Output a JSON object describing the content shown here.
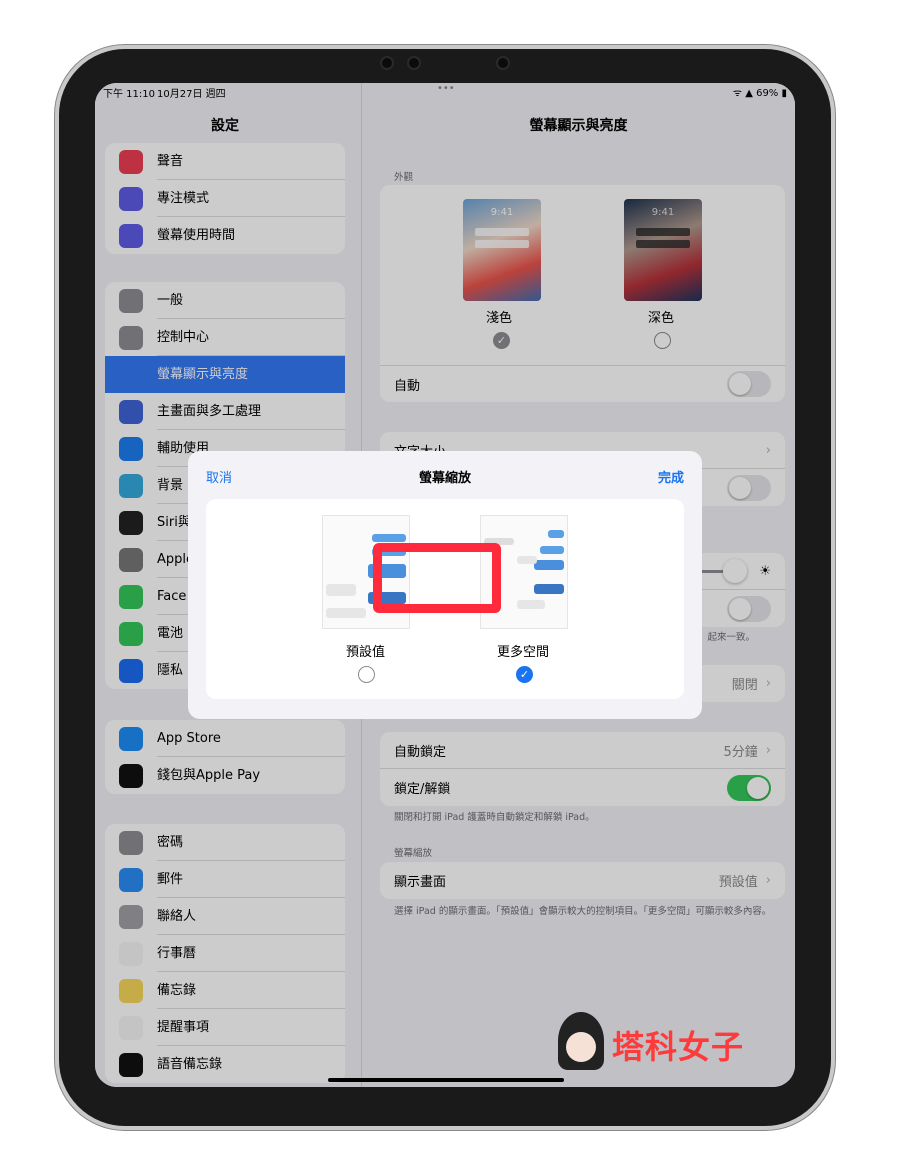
{
  "status": {
    "time": "下午 11:10",
    "date": "10月27日 週四",
    "battery": "69%"
  },
  "sidebar": {
    "title": "設定",
    "groups": [
      [
        {
          "label": "聲音",
          "icon": "speaker-icon",
          "color": "#ee3e54"
        },
        {
          "label": "專注模式",
          "icon": "moon-icon",
          "color": "#5e5ce6"
        },
        {
          "label": "螢幕使用時間",
          "icon": "hourglass-icon",
          "color": "#5e5ce6"
        }
      ],
      [
        {
          "label": "一般",
          "icon": "gear-icon",
          "color": "#8e8e93"
        },
        {
          "label": "控制中心",
          "icon": "toggles-icon",
          "color": "#8e8e93"
        },
        {
          "label": "螢幕顯示與亮度",
          "icon": "text-size-icon",
          "color": "#3478f6",
          "selected": true
        },
        {
          "label": "主畫面與多工處理",
          "icon": "grid-icon",
          "color": "#3f63d8"
        },
        {
          "label": "輔助使用",
          "icon": "accessibility-icon",
          "color": "#1c7cf0"
        },
        {
          "label": "背景",
          "icon": "flower-icon",
          "color": "#35aadc"
        },
        {
          "label": "Siri與",
          "icon": "siri-icon",
          "color": "#222"
        },
        {
          "label": "Apple",
          "icon": "pencil-icon",
          "color": "#777"
        },
        {
          "label": "Face",
          "icon": "faceid-icon",
          "color": "#34c759"
        },
        {
          "label": "電池",
          "icon": "battery-icon",
          "color": "#34c759"
        },
        {
          "label": "隱私",
          "icon": "hand-icon",
          "color": "#1c6cf0"
        }
      ],
      [
        {
          "label": "App Store",
          "icon": "appstore-icon",
          "color": "#1c8cf5"
        },
        {
          "label": "錢包與Apple Pay",
          "icon": "wallet-icon",
          "color": "#111"
        }
      ],
      [
        {
          "label": "密碼",
          "icon": "key-icon",
          "color": "#8e8e93"
        },
        {
          "label": "郵件",
          "icon": "mail-icon",
          "color": "#2a8cf5"
        },
        {
          "label": "聯絡人",
          "icon": "contacts-icon",
          "color": "#a0a0a5"
        },
        {
          "label": "行事曆",
          "icon": "calendar-icon",
          "color": "#f5f5f5"
        },
        {
          "label": "備忘錄",
          "icon": "notes-icon",
          "color": "#f7d75a"
        },
        {
          "label": "提醒事項",
          "icon": "reminders-icon",
          "color": "#f5f5f5"
        },
        {
          "label": "語音備忘錄",
          "icon": "voice-memo-icon",
          "color": "#111"
        }
      ]
    ]
  },
  "detail": {
    "title": "螢幕顯示與亮度",
    "appearance": {
      "header": "外觀",
      "time": "9:41",
      "light": "淺色",
      "dark": "深色",
      "selected": "light",
      "auto_label": "自動",
      "auto_on": false
    },
    "text_size": "文字大小",
    "truecolor_note": "起來一致。",
    "night_shift_value": "關閉",
    "auto_lock": {
      "label": "自動鎖定",
      "value": "5分鐘"
    },
    "lock_unlock": {
      "label": "鎖定/解鎖",
      "on": true,
      "footer": "關閉和打開 iPad 護蓋時自動鎖定和解鎖 iPad。"
    },
    "zoom": {
      "header": "螢幕縮放",
      "label": "顯示畫面",
      "value": "預設值",
      "footer": "選擇 iPad 的顯示畫面。「預設值」會顯示較大的控制項目。「更多空間」可顯示較多內容。"
    }
  },
  "modal": {
    "title": "螢幕縮放",
    "cancel": "取消",
    "done": "完成",
    "options": [
      {
        "label": "預設值",
        "selected": false
      },
      {
        "label": "更多空間",
        "selected": true
      }
    ]
  },
  "watermark": "塔科女子",
  "colors": {
    "accent": "#1a73f0",
    "highlight": "#ff2a3c",
    "toggle_on": "#34c759"
  }
}
